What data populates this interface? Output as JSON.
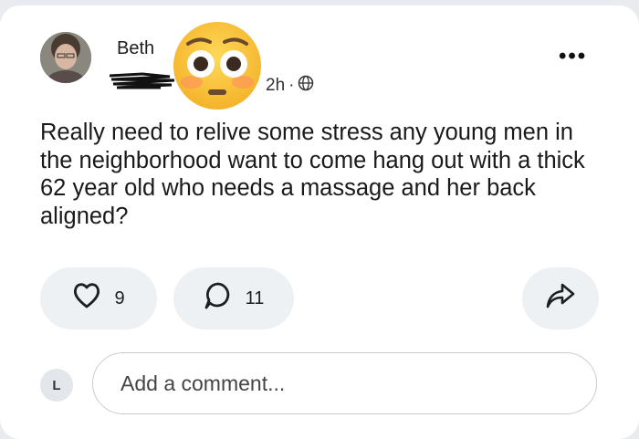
{
  "post": {
    "author_name": "Beth",
    "time": "2h",
    "separator": "·",
    "privacy_icon": "globe-icon",
    "more_icon": "more-horizontal-icon",
    "text": "Really need to relive some stress any young men in the neighborhood want to come hang out with a thick 62 year old who needs a massage and her back aligned?",
    "overlay_emoji": "flushed-face-emoji"
  },
  "actions": {
    "like_count": "9",
    "comment_count": "11",
    "share_icon": "share-arrow-icon"
  },
  "comment": {
    "user_initial": "L",
    "placeholder": "Add a comment..."
  }
}
